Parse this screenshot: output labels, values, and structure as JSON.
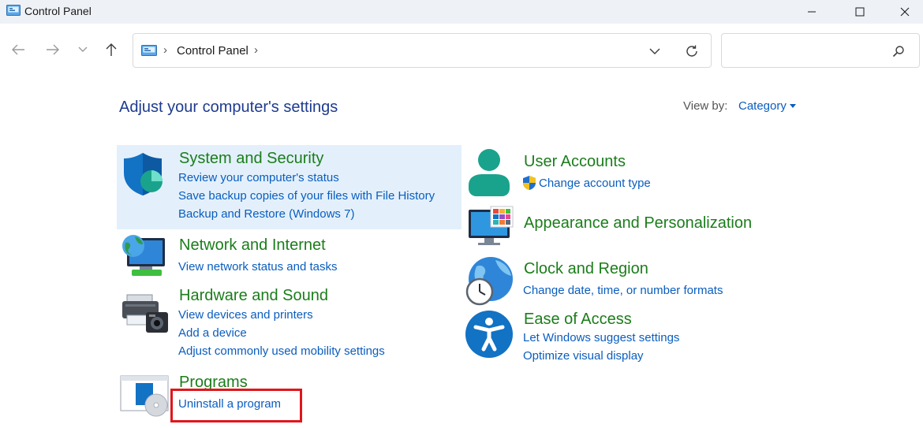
{
  "window": {
    "title": "Control Panel"
  },
  "nav": {
    "back_glyph": "←",
    "forward_glyph": "→",
    "recent_glyph": "⌄",
    "up_glyph": "↑"
  },
  "address": {
    "separator": "›",
    "path": "Control Panel"
  },
  "search": {
    "value": "",
    "placeholder": ""
  },
  "content": {
    "heading": "Adjust your computer's settings",
    "view_by_label": "View by:",
    "view_by_value": "Category"
  },
  "categories": {
    "system_security": {
      "title": "System and Security",
      "links": [
        "Review your computer's status",
        "Save backup copies of your files with File History",
        "Backup and Restore (Windows 7)"
      ]
    },
    "network": {
      "title": "Network and Internet",
      "links": [
        "View network status and tasks"
      ]
    },
    "hardware": {
      "title": "Hardware and Sound",
      "links": [
        "View devices and printers",
        "Add a device",
        "Adjust commonly used mobility settings"
      ]
    },
    "programs": {
      "title": "Programs",
      "links": [
        "Uninstall a program"
      ]
    },
    "user_accounts": {
      "title": "User Accounts",
      "links": [
        "Change account type"
      ]
    },
    "appearance": {
      "title": "Appearance and Personalization",
      "links": []
    },
    "clock": {
      "title": "Clock and Region",
      "links": [
        "Change date, time, or number formats"
      ]
    },
    "ease": {
      "title": "Ease of Access",
      "links": [
        "Let Windows suggest settings",
        "Optimize visual display"
      ]
    }
  },
  "colors": {
    "heading": "#1e3b8f",
    "category_title": "#1b7d1b",
    "link": "#0a5dbf",
    "highlight": "#e3f0fb",
    "annotation": "#e0161c"
  }
}
